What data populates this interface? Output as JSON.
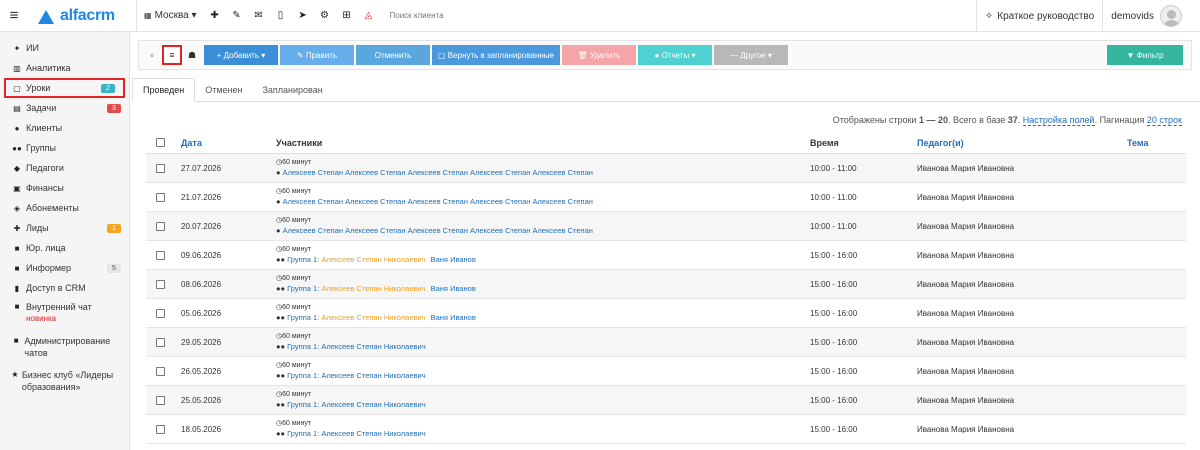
{
  "colors": {
    "accent": "#1e88e5",
    "add": "#3b8fd6",
    "edit": "#66adeb",
    "cancel": "#5aa7e0",
    "return": "#4a99dd",
    "delete": "#f3a5a8",
    "reports": "#4fd1d1",
    "other": "#b8b8b8",
    "filter": "#33b5a0",
    "selected_border": "#e02424"
  },
  "header": {
    "logo": "alfacrm",
    "branch": "Москва ▾",
    "search_placeholder": "Поиск клиента",
    "guide": "Краткое руководство",
    "user": "demovids",
    "icons": [
      "plus-icon",
      "wrench-icon",
      "mail-icon",
      "phone-icon",
      "telegram-icon",
      "gear-icon",
      "cart-icon",
      "bell-icon"
    ]
  },
  "sidebar": {
    "items": [
      {
        "label": "ИИ",
        "icon": "ai-icon",
        "badge": ""
      },
      {
        "label": "Аналитика",
        "icon": "analytics-icon",
        "badge": ""
      },
      {
        "label": "Уроки",
        "icon": "calendar-icon",
        "badge": "2"
      },
      {
        "label": "Задачи",
        "icon": "tasks-icon",
        "badge": "3"
      },
      {
        "label": "Клиенты",
        "icon": "user-icon",
        "badge": ""
      },
      {
        "label": "Группы",
        "icon": "group-icon",
        "badge": ""
      },
      {
        "label": "Педагоги",
        "icon": "teacher-icon",
        "badge": ""
      },
      {
        "label": "Финансы",
        "icon": "money-icon",
        "badge": ""
      },
      {
        "label": "Абонементы",
        "icon": "tag-icon",
        "badge": ""
      },
      {
        "label": "Лиды",
        "icon": "lead-icon",
        "badge": "1"
      },
      {
        "label": "Юр. лица",
        "icon": "briefcase-icon",
        "badge": ""
      },
      {
        "label": "Информер",
        "icon": "informer-icon",
        "badge": "5"
      },
      {
        "label": "Доступ в CRM",
        "icon": "lock-icon",
        "badge": ""
      }
    ],
    "chat": {
      "label": "Внутренний чат",
      "new": "новинка"
    },
    "admin": {
      "label": "Администрирование чатов"
    },
    "club": {
      "label": "Бизнес клуб «Лидеры образования»"
    }
  },
  "toolbar": {
    "add": "+ Добавить ▾",
    "edit": "✎ Править",
    "cancel": "Отменить",
    "return": "▢ Вернуть в запланированные",
    "delete": "🗑 Удалить",
    "reports": "● Отчеты ▾",
    "other": "— Другое ▾",
    "filter": "▼ Фильтр"
  },
  "tabs": [
    "Проведен",
    "Отменен",
    "Запланирован"
  ],
  "info": {
    "prefix": "Отображены строки ",
    "range": "1 — 20",
    "middle": ". Всего в базе ",
    "total": "37",
    "after": ".",
    "settings": "Настройка полей",
    "pag_label": ". Пагинация ",
    "pagination": "20 строк"
  },
  "table": {
    "headers": {
      "date": "Дата",
      "participants": "Участники",
      "time": "Время",
      "teacher": "Педагог(и)",
      "topic": "Тема"
    },
    "rows": [
      {
        "date": "27.07.2026",
        "duration": "60 минут",
        "kind": "single",
        "p1": "Алексеев Степан Алексеев Степан Алексеев Степан Алексеев Степан Алексеев Степан",
        "p2": "",
        "p3": "",
        "time": "10:00 - 11:00",
        "teacher": "Иванова Мария Ивановна"
      },
      {
        "date": "21.07.2026",
        "duration": "60 минут",
        "kind": "single",
        "p1": "Алексеев Степан Алексеев Степан Алексеев Степан Алексеев Степан Алексеев Степан",
        "p2": "",
        "p3": "",
        "time": "10:00 - 11:00",
        "teacher": "Иванова Мария Ивановна"
      },
      {
        "date": "20.07.2026",
        "duration": "60 минут",
        "kind": "single",
        "p1": "Алексеев Степан Алексеев Степан Алексеев Степан Алексеев Степан Алексеев Степан",
        "p2": "",
        "p3": "",
        "time": "10:00 - 11:00",
        "teacher": "Иванова Мария Ивановна"
      },
      {
        "date": "09.06.2026",
        "duration": "60 минут",
        "kind": "group",
        "p1": "Группа 1: ",
        "p2": "Алексеев Степан Николаевич",
        "p3": "Ваня Иванов",
        "time": "15:00 - 16:00",
        "teacher": "Иванова Мария Ивановна"
      },
      {
        "date": "08.06.2026",
        "duration": "60 минут",
        "kind": "group",
        "p1": "Группа 1: ",
        "p2": "Алексеев Степан Николаевич",
        "p3": "Ваня Иванов",
        "time": "15:00 - 16:00",
        "teacher": "Иванова Мария Ивановна"
      },
      {
        "date": "05.06.2026",
        "duration": "60 минут",
        "kind": "group",
        "p1": "Группа 1: ",
        "p2": "Алексеев Степан Николаевич",
        "p3": "Ваня Иванов",
        "time": "15:00 - 16:00",
        "teacher": "Иванова Мария Ивановна"
      },
      {
        "date": "29.05.2026",
        "duration": "60 минут",
        "kind": "group2",
        "p1": "Группа 1: Алексеев Степан Николаевич",
        "p2": "",
        "p3": "",
        "time": "15:00 - 16:00",
        "teacher": "Иванова Мария Ивановна"
      },
      {
        "date": "26.05.2026",
        "duration": "60 минут",
        "kind": "group2",
        "p1": "Группа 1: Алексеев Степан Николаевич",
        "p2": "",
        "p3": "",
        "time": "15:00 - 16:00",
        "teacher": "Иванова Мария Ивановна"
      },
      {
        "date": "25.05.2026",
        "duration": "60 минут",
        "kind": "group2",
        "p1": "Группа 1: Алексеев Степан Николаевич",
        "p2": "",
        "p3": "",
        "time": "15:00 - 16:00",
        "teacher": "Иванова Мария Ивановна"
      },
      {
        "date": "18.05.2026",
        "duration": "60 минут",
        "kind": "group2",
        "p1": "Группа 1: Алексеев Степан Николаевич",
        "p2": "",
        "p3": "",
        "time": "15:00 - 16:00",
        "teacher": "Иванова Мария Ивановна"
      }
    ]
  }
}
